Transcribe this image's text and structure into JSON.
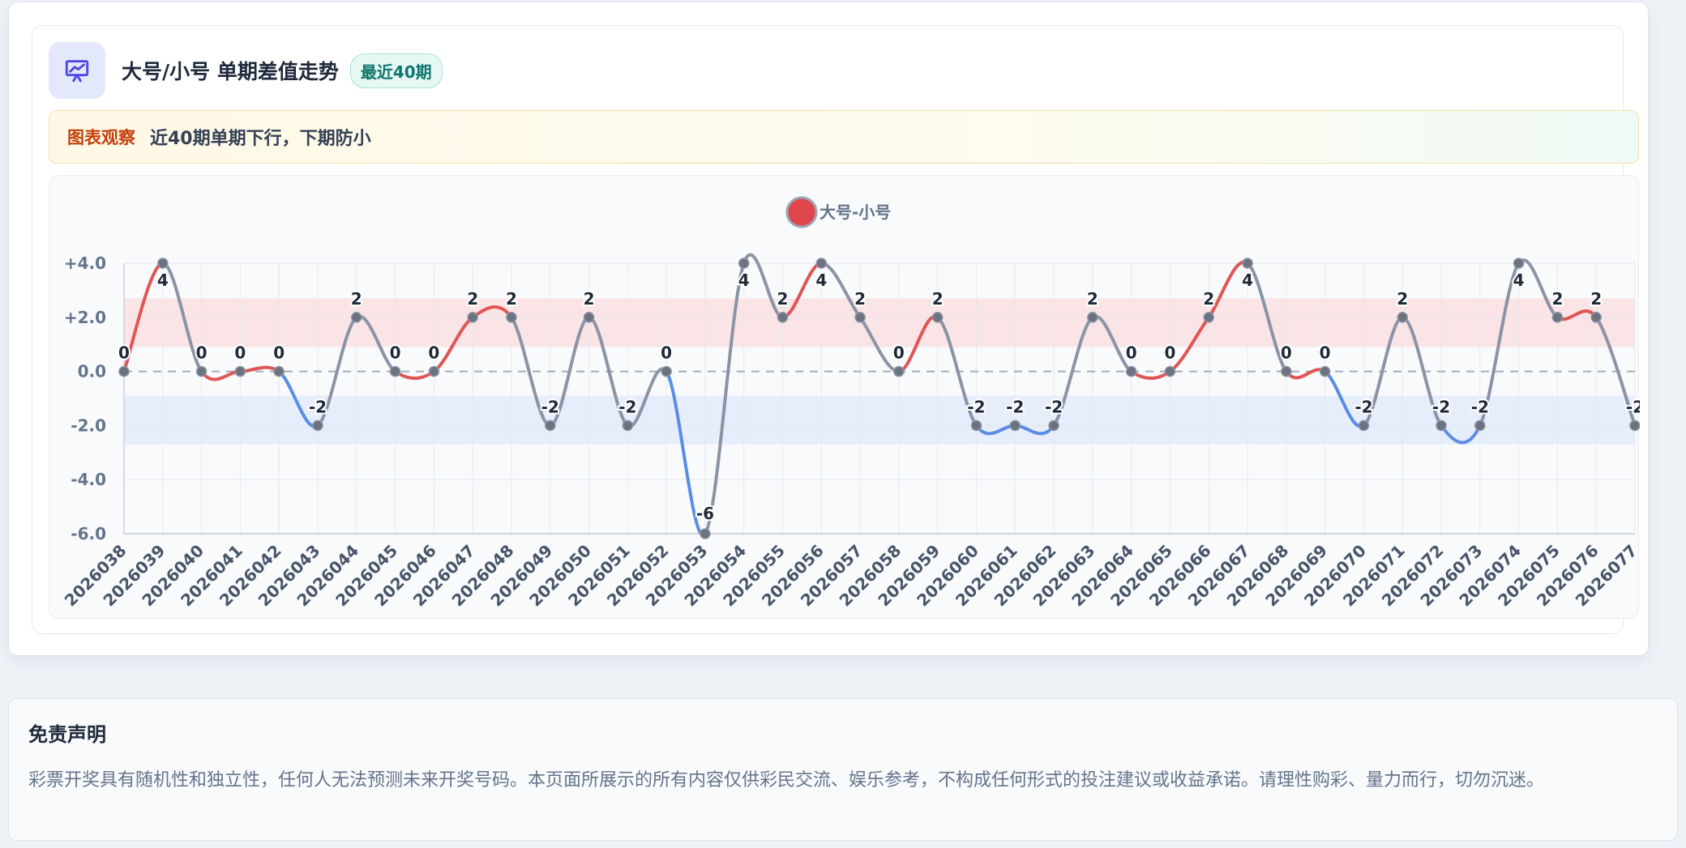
{
  "header": {
    "title": "大号/小号 单期差值走势",
    "badge": "最近40期",
    "icon": "presentation-chart-icon"
  },
  "observation": {
    "label": "图表观察",
    "text": "近40期单期下行，下期防小"
  },
  "disclaimer": {
    "title": "免责声明",
    "text": "彩票开奖具有随机性和独立性，任何人无法预测未来开奖号码。本页面所展示的所有内容仅供彩民交流、娱乐参考，不构成任何形式的投注建议或收益承诺。请理性购彩、量力而行，切勿沉迷。"
  },
  "colors": {
    "up": "#e05555",
    "down": "#5b8de6",
    "flat": "#8b94a6",
    "upBand": "#fbe4e6",
    "downBand": "#e6eefb"
  },
  "chart_data": {
    "type": "line",
    "x": [
      "2026038",
      "2026039",
      "2026040",
      "2026041",
      "2026042",
      "2026043",
      "2026044",
      "2026045",
      "2026046",
      "2026047",
      "2026048",
      "2026049",
      "2026050",
      "2026051",
      "2026052",
      "2026053",
      "2026054",
      "2026055",
      "2026056",
      "2026057",
      "2026058",
      "2026059",
      "2026060",
      "2026061",
      "2026062",
      "2026063",
      "2026064",
      "2026065",
      "2026066",
      "2026067",
      "2026068",
      "2026069",
      "2026070",
      "2026071",
      "2026072",
      "2026073",
      "2026074",
      "2026075",
      "2026076",
      "2026077"
    ],
    "series": [
      {
        "name": "大号-小号",
        "values": [
          0,
          4,
          0,
          0,
          0,
          -2,
          2,
          0,
          0,
          2,
          2,
          -2,
          2,
          -2,
          0,
          -6,
          4,
          2,
          4,
          2,
          0,
          2,
          -2,
          -2,
          -2,
          2,
          0,
          0,
          2,
          4,
          0,
          0,
          -2,
          2,
          -2,
          -2,
          4,
          2,
          2,
          -2
        ]
      }
    ],
    "ylim": [
      -6,
      4
    ],
    "yticks": [
      4,
      2,
      0,
      -2,
      -4,
      -6
    ],
    "ytick_labels": [
      "+4.0",
      "+2.0",
      "0.0",
      "-2.0",
      "-4.0",
      "-6.0"
    ],
    "bands": [
      {
        "from": 0.9,
        "to": 2.7,
        "kind": "up"
      },
      {
        "from": -2.7,
        "to": -0.9,
        "kind": "down"
      }
    ],
    "grid": true,
    "legend": "top-center",
    "data_labels": true
  }
}
